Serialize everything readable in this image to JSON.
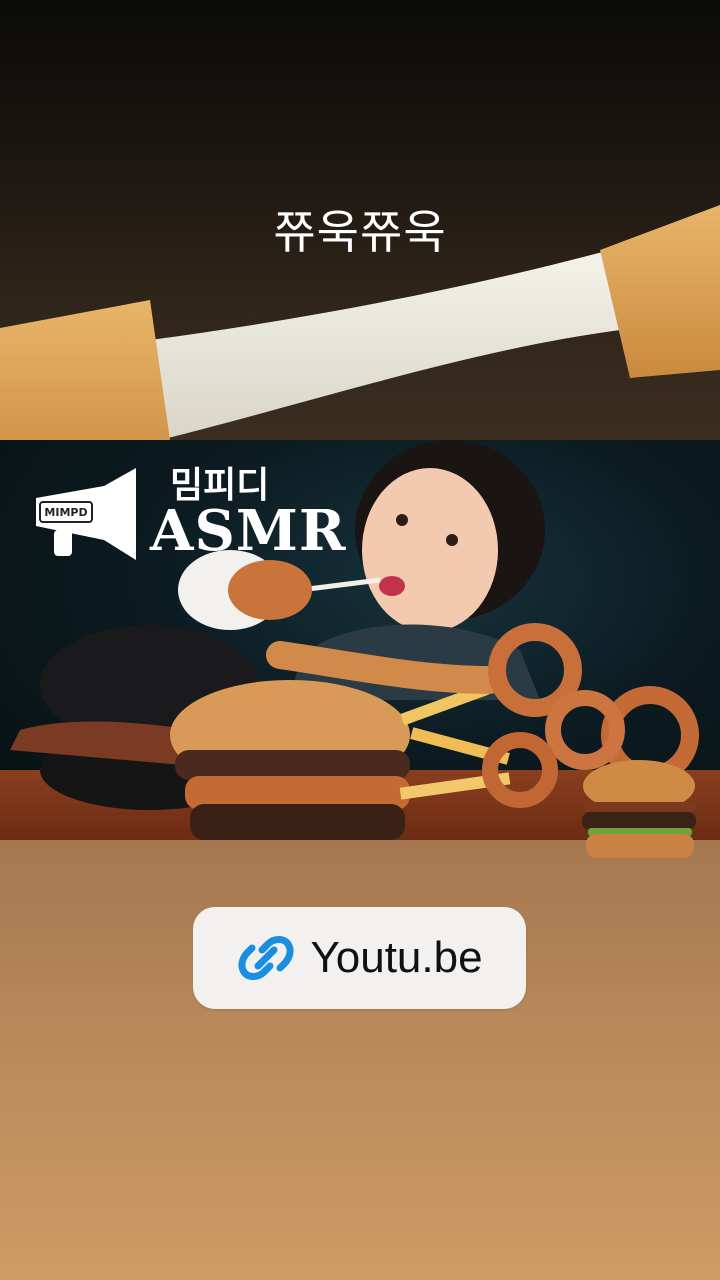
{
  "sticker": {
    "text": "쮸욱쮸욱"
  },
  "thumbnail": {
    "brand_korean": "밈피디",
    "brand_asmr": "ASMR",
    "megaphone_label": "MIMPD"
  },
  "link": {
    "label": "Youtu.be",
    "icon": "link-icon",
    "accent": "#1a8fe0"
  }
}
